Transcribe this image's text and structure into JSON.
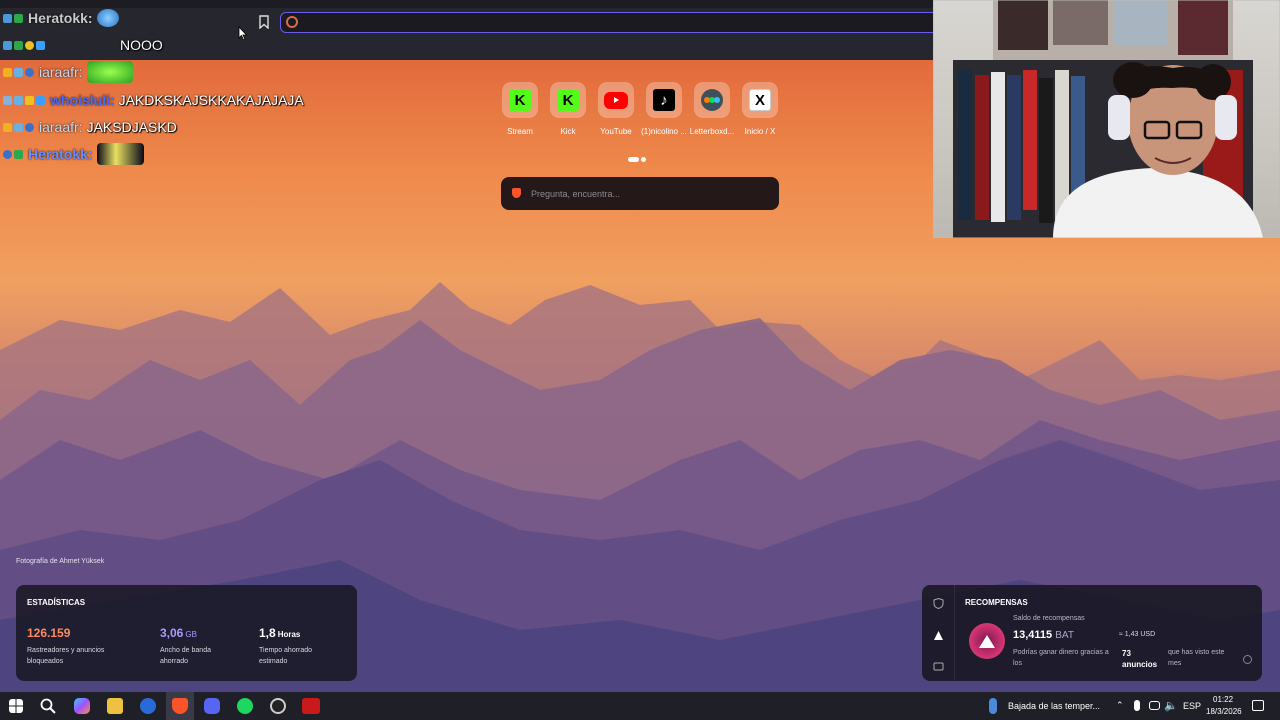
{
  "browser": {
    "address_value": "",
    "bookmark_icon": "bookmark-icon"
  },
  "chat": {
    "messages": [
      {
        "user": "Heratokk:",
        "text": "",
        "user_color": "#c8c8c8"
      },
      {
        "user": "",
        "text": "NOOO",
        "user_color": "#3aa0ff"
      },
      {
        "user": "iaraafr:",
        "text": "",
        "user_color": "#c9d8e8"
      },
      {
        "user": "whoisluli:",
        "text": "JAKDKSKAJSKKAKAJAJAJA",
        "user_color": "#4a6cf5"
      },
      {
        "user": "iaraafr:",
        "text": "JAKSDJASKD",
        "user_color": "#c9d8e8"
      },
      {
        "user": "Heratokk:",
        "text": "",
        "user_color": "#6b8cff"
      }
    ]
  },
  "top_sites": [
    {
      "label": "Stream",
      "icon": "kick-icon",
      "glyph": "K"
    },
    {
      "label": "Kick",
      "icon": "kick-icon",
      "glyph": "K"
    },
    {
      "label": "YouTube",
      "icon": "youtube-icon",
      "glyph": ""
    },
    {
      "label": "(1)nicolino ...",
      "icon": "tiktok-icon",
      "glyph": "♪"
    },
    {
      "label": "Letterboxd...",
      "icon": "letterboxd-icon",
      "glyph": ""
    },
    {
      "label": "Inicio / X",
      "icon": "x-icon",
      "glyph": "X"
    }
  ],
  "search": {
    "placeholder": "Pregunta, encuentra..."
  },
  "photo_credit": "Fotografía de Ahmet Yüksek",
  "stats": {
    "title": "ESTADÍSTICAS",
    "trackers": {
      "value": "126.159",
      "unit": "",
      "desc1": "Rastreadores y anuncios",
      "desc2": "bloqueados",
      "color": "#ff8a5c"
    },
    "bandwidth": {
      "value": "3,06",
      "unit": "GB",
      "desc1": "Ancho de banda",
      "desc2": "ahorrado",
      "color": "#a99bff"
    },
    "time": {
      "value": "1,8",
      "unit": "Horas",
      "desc1": "Tiempo ahorrado",
      "desc2": "estimado",
      "color": "#ffffff"
    }
  },
  "rewards": {
    "title": "RECOMPENSAS",
    "balance_label": "Saldo de recompensas",
    "balance": "13,4115",
    "currency": "BAT",
    "usd": "≈ 1,43 USD",
    "earn_text": "Podrías ganar dinero gracias a los",
    "ads_count": "73",
    "ads_label": "anuncios",
    "seen_text": "que has visto este mes"
  },
  "taskbar": {
    "weather": "Bajada de las temper...",
    "language": "ESP",
    "time": "01:22",
    "date": "18/3/2026"
  }
}
